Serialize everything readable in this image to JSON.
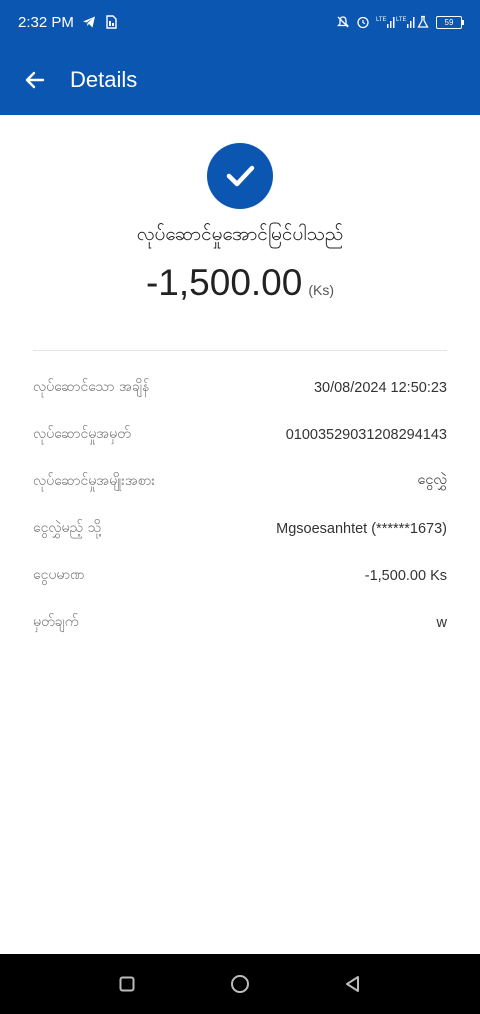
{
  "status_bar": {
    "time": "2:32 PM",
    "battery": "59",
    "icons": [
      "telegram-icon",
      "sim-icon",
      "mute-icon",
      "alarm-icon",
      "lte-signal-icon",
      "lte-signal-icon",
      "lab-icon",
      "battery-icon"
    ]
  },
  "app_bar": {
    "title": "Details"
  },
  "transaction": {
    "status_text": "လုပ်ဆောင်မှုအောင်မြင်ပါသည်",
    "amount": "-1,500.00",
    "unit": "(Ks)"
  },
  "details": [
    {
      "label": "လုပ်ဆောင်သော အချိန်",
      "value": "30/08/2024 12:50:23"
    },
    {
      "label": "လုပ်ဆောင်မှုအမှတ်",
      "value": "01003529031208294143"
    },
    {
      "label": "လုပ်ဆောင်မှုအမျိုးအစား",
      "value": "ငွေလွှဲ"
    },
    {
      "label": "ငွေလွှဲမည့် သို့",
      "value": "Mgsoesanhtet (******1673)"
    },
    {
      "label": "ငွေပမာဏ",
      "value": "-1,500.00 Ks"
    },
    {
      "label": "မှတ်ချက်",
      "value": "w"
    }
  ],
  "colors": {
    "primary": "#0a56b0",
    "nav_bar": "#000000"
  }
}
